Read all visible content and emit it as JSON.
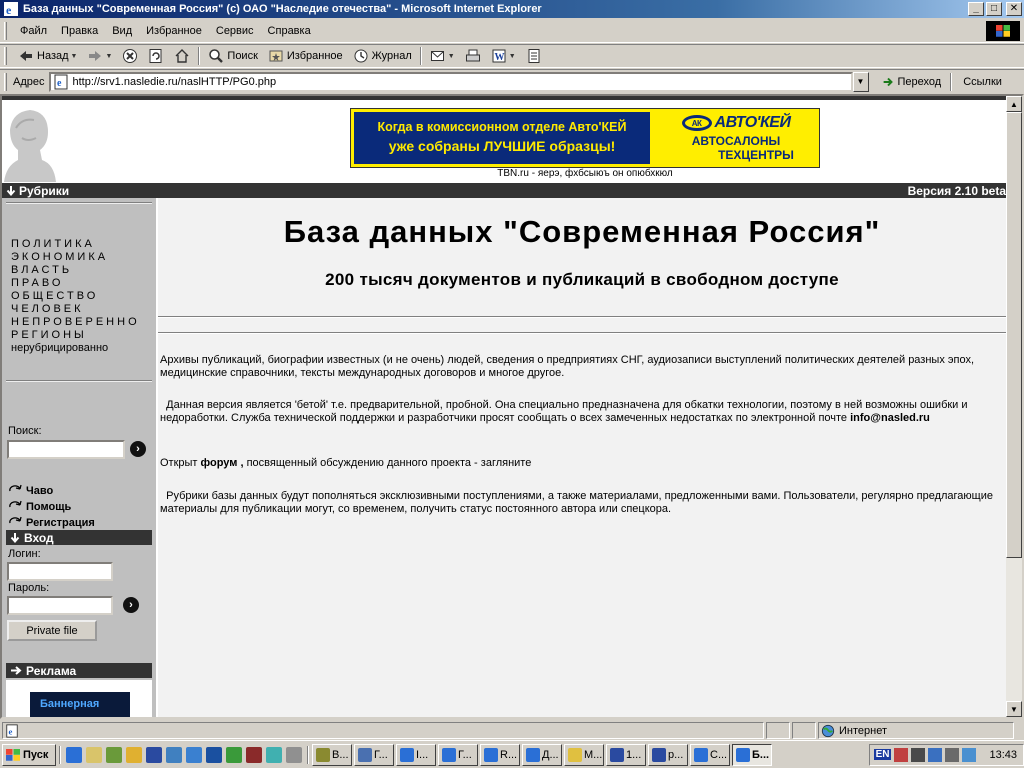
{
  "window": {
    "title": "База данных \"Современная Россия\" (c) ОАО \"Наследие отечества\" - Microsoft Internet Explorer",
    "buttons": {
      "minimize": "_",
      "maximize": "□",
      "close": "✕"
    }
  },
  "menu": [
    "Файл",
    "Правка",
    "Вид",
    "Избранное",
    "Сервис",
    "Справка"
  ],
  "toolbar": {
    "back": "Назад",
    "search": "Поиск",
    "favorites": "Избранное",
    "history": "Журнал"
  },
  "address": {
    "label": "Адрес",
    "url": "http://srv1.nasledie.ru/naslHTTP/PG0.php",
    "go": "Переход",
    "links": "Ссылки"
  },
  "page": {
    "banner": {
      "line1": "Когда в комиссионном отделе Авто'КЕЙ",
      "line2": "уже собраны ЛУЧШИЕ образцы!",
      "brand": "АВТО'КЕЙ",
      "brand_mark": "АК",
      "sub1": "АВТОСАЛОНЫ",
      "sub2": "ТЕХЦЕНТРЫ"
    },
    "tbn": "TBN.ru - яерэ, фхбсыюъ он опюбхкюл",
    "rubrics_label": "Рубрики",
    "version": "Версия 2.10 beta",
    "categories": [
      "ПОЛИТИКА",
      "ЭКОНОМИКА",
      "ВЛАСТЬ",
      "ПРАВО",
      "ОБЩЕСТВО",
      "ЧЕЛОВЕК",
      "НЕПРОВЕРЕННО",
      "РЕГИОНЫ",
      "нерубрицированно"
    ],
    "search_label": "Поиск:",
    "links": [
      "Чаво",
      "Помощь",
      "Регистрация"
    ],
    "login_header": "Вход",
    "login_label": "Логин:",
    "password_label": "Пароль:",
    "private_button": "Private file",
    "ad_header": "Реклама",
    "ad_banner": "Баннерная",
    "title": "База данных \"Современная Россия\"",
    "subtitle": "200 тысяч документов и публикаций в свободном доступе",
    "para1": " Архивы публикаций, биографии известных (и не очень) людей, сведения о предприятиях СНГ, аудиозаписи выступлений политических деятелей разных эпох, медицинские справочники, тексты международных договоров и многое другое.",
    "para2_text": "  Данная версия является 'бетой' т.е. предварительной, пробной. Она специально предназначена для обкатки технологии, поэтому в ней возможны ошибки и недоработки. Служба технической поддержки и разработчики просят сообщать о всех замеченных недостатках по электронной почте ",
    "para2_email": "info@nasled.ru",
    "para3_pre": "Открыт ",
    "para3_forum": "форум ,",
    "para3_post": " посвященный обсуждению данного проекта - загляните",
    "para4": "  Рубрики базы данных будут пополняться эксклюзивными поступлениями, а также материалами, предложенными вами. Пользователи, регулярно предлагающие материалы для публикации могут, со временем, получить статус постоянного автора или спецкора."
  },
  "status": {
    "zone": "Интернет"
  },
  "taskbar": {
    "start": "Пуск",
    "tasks": [
      "В...",
      "Г...",
      "I...",
      "Г...",
      "R...",
      "Д...",
      "М...",
      "1...",
      "р...",
      "С...",
      "Б..."
    ],
    "lang": "EN",
    "clock": "13:43"
  }
}
